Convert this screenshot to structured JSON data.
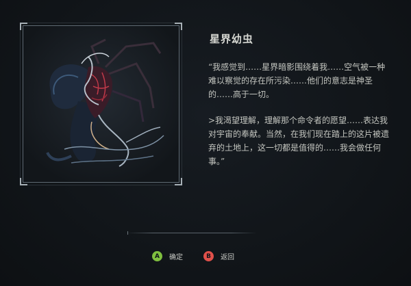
{
  "entry": {
    "title": "星界幼虫",
    "paragraphs": [
      "“我感觉到……星界暗影围绕着我……空气被一种难以察觉的存在所污染……他们的意志是神圣的……高于一切。",
      ">我渴望理解，理解那个命令者的愿望……表达我对宇宙的奉献。当然，在我们现在踏上的这片被遗弃的土地上，这一切都是值得的……我会做任何事。”"
    ]
  },
  "controls": {
    "confirm": {
      "glyph": "A",
      "label": "确定",
      "color": "#7fbf3f"
    },
    "back": {
      "glyph": "B",
      "label": "返回",
      "color": "#e0504a"
    }
  },
  "colors": {
    "background": "#121619",
    "frame": "#5f6a73",
    "text": "#c9cbc6"
  },
  "icons": {
    "portrait": "astral-larva-creature-portrait"
  }
}
